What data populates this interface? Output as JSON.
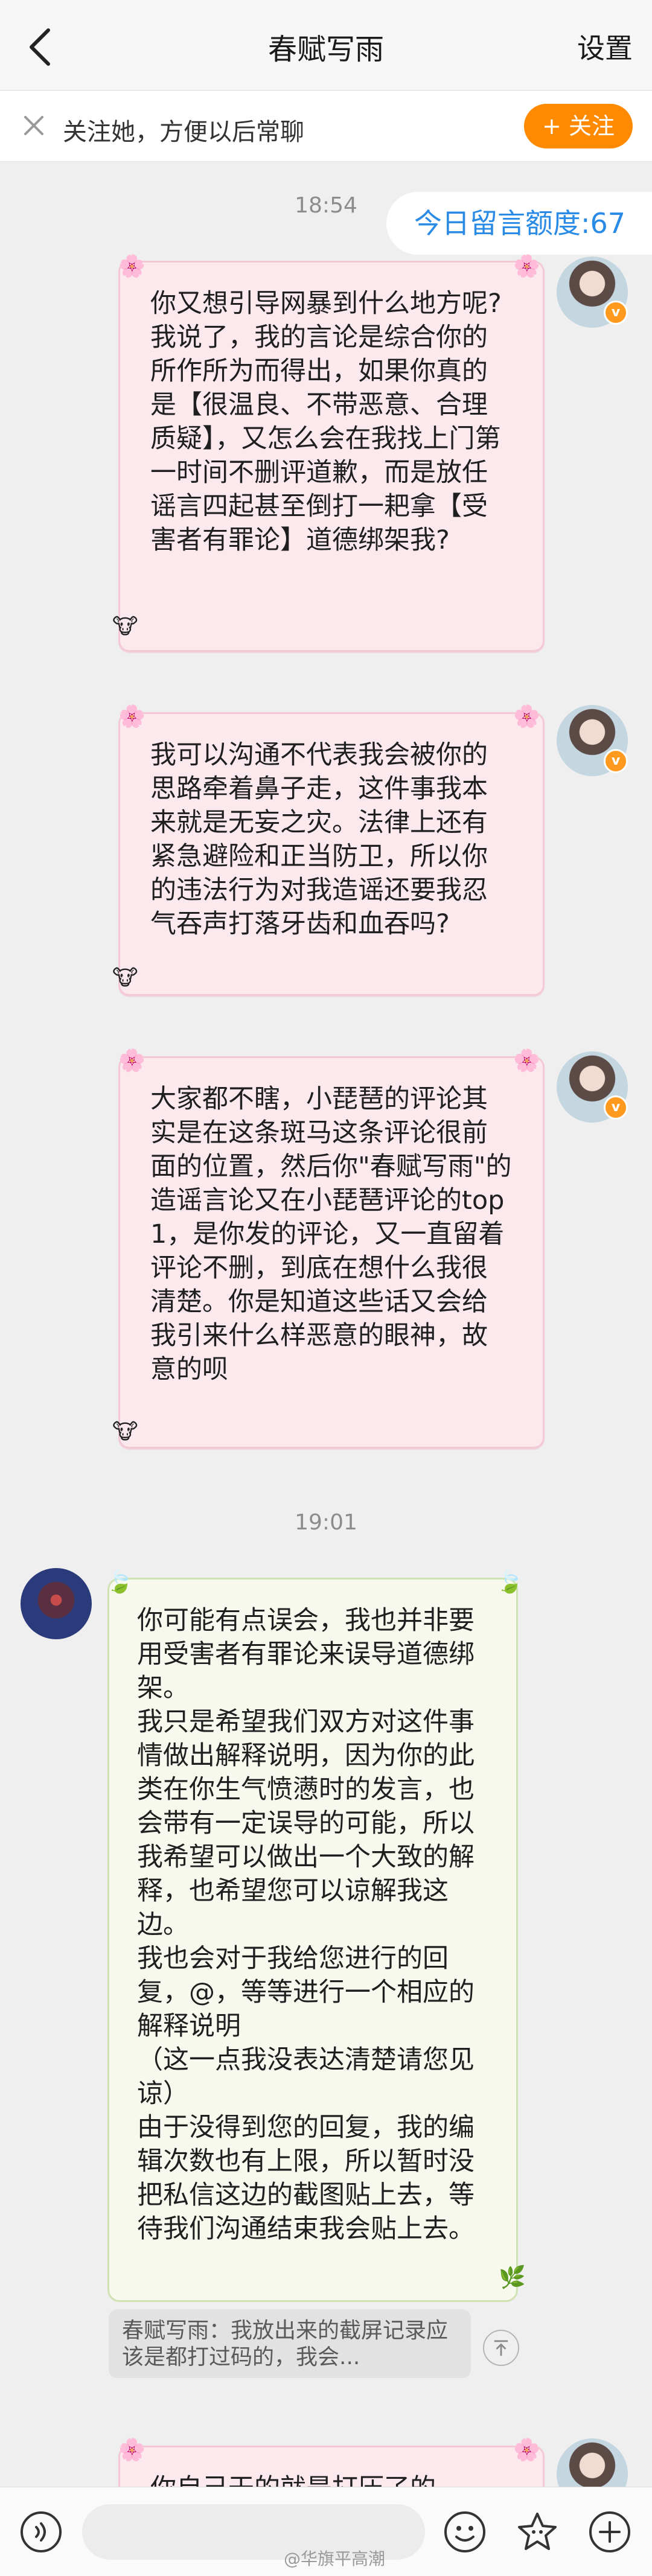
{
  "header": {
    "title": "春赋写雨",
    "settings_label": "设置"
  },
  "follow_bar": {
    "text": "关注她，方便以后常聊",
    "button_label": "+ 关注"
  },
  "chat": {
    "quota_label": "今日留言额度:67",
    "times": [
      "18:54",
      "19:01"
    ],
    "messages": [
      {
        "side": "right",
        "text": "你又想引导网暴到什么地方呢?\n我说了，我的言论是综合你的所作所为而得出，如果你真的是【很温良、不带恶意、合理质疑】，又怎么会在我找上门第一时间不删评道歉，而是放任谣言四起甚至倒打一耙拿【受害者有罪论】道德绑架我?"
      },
      {
        "side": "right",
        "text": "我可以沟通不代表我会被你的思路牵着鼻子走，这件事我本来就是无妄之灾。法律上还有紧急避险和正当防卫，所以你的违法行为对我造谣还要我忍气吞声打落牙齿和血吞吗?"
      },
      {
        "side": "right",
        "text": "大家都不瞎，小琵琶的评论其实是在这条斑马这条评论很前面的位置，然后你\"春赋写雨\"的造谣言论又在小琵琶评论的top1，是你发的评论，又一直留着评论不删，到底在想什么我很清楚。你是知道这些话又会给我引来什么样恶意的眼神，故意的呗"
      },
      {
        "side": "left",
        "text": "你可能有点误会，我也并非要用受害者有罪论来误导道德绑架。\n我只是希望我们双方对这件事情做出解释说明，因为你的此类在你生气愤懑时的发言，也会带有一定误导的可能，所以我希望可以做出一个大致的解释，也希望您可以谅解我这边。\n我也会对于我给您进行的回复，@，等等进行一个相应的解释说明\n（这一点我没表达清楚请您见谅）\n由于没得到您的回复，我的编辑次数也有上限，所以暂时没把私信这边的截图贴上去，等待我们沟通结束我会贴上去。"
      },
      {
        "side": "right",
        "text": "你自己干的就是打压了的"
      }
    ],
    "quoted_reply": "春赋写雨：我放出来的截屏记录应该是都打过码的，我会..."
  },
  "bottom_bar": {
    "watermark": "@华旗平高潮"
  },
  "colors": {
    "accent_orange": "#ff8a00",
    "quota_blue": "#2a8be6",
    "pink_bubble": "#fbe9ee",
    "green_bubble": "#f7f9ef"
  },
  "icons": [
    "back-arrow-icon",
    "close-icon",
    "voice-icon",
    "emoji-icon",
    "sticker-icon",
    "plus-icon",
    "scroll-up-icon"
  ]
}
